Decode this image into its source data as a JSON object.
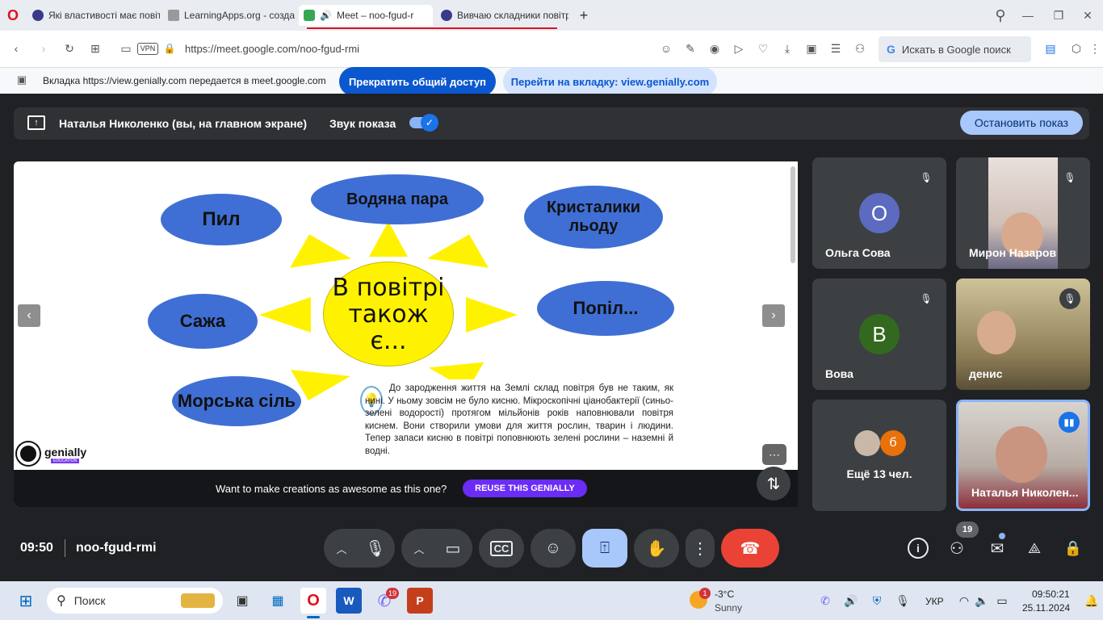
{
  "tabs": [
    {
      "label": "Які властивості має повіт",
      "color": "#3a3a8a"
    },
    {
      "label": "LearningApps.org - созда",
      "color": "#888"
    },
    {
      "label": "Meet – noo-fgud-r",
      "color": "#34a853"
    },
    {
      "label": "Вивчаю складники повітр",
      "color": "#3a3a8a"
    }
  ],
  "tabbar": {
    "new_tab": "+",
    "search": "⚲",
    "minimize": "—",
    "restore": "❐",
    "close": "✕"
  },
  "address": {
    "url": "https://meet.google.com/noo-fgud-rmi",
    "vpn": "VPN",
    "search_placeholder": "Искать в Google поиск"
  },
  "share_bar": {
    "message": "Вкладка https://view.genially.com передается в meet.google.com",
    "stop_label": "Прекратить общий доступ",
    "switch_label": "Перейти на вкладку: view.genially.com"
  },
  "presenter_bar": {
    "presenter": "Наталья Николенко (вы, на главном экране)",
    "sound_label": "Звук показа",
    "stop_label": "Остановить показ"
  },
  "slide": {
    "center_text": "В повітрі також є...",
    "clouds": [
      "Водяна пара",
      "Пил",
      "Кристалики льоду",
      "Сажа",
      "Попіл...",
      "Морська сіль"
    ],
    "paragraph": "До зародження життя на Землі склад повітря був не таким, як нині. У ньому зовсім не було кисню. Мікроскопічні ціанобактерії (синьо-зелені водорості) протягом мільйонів років наповнювали повітря киснем. Вони створили умови для життя рослин, тварин і людини. Тепер запаси кисню в повітрі поповнюють зелені рослини – наземні й водні.",
    "brand": "genially",
    "brand_sub": "EDUCATION",
    "prev": "‹",
    "next": "›",
    "more": "⋯",
    "promo_text": "Want to make creations as awesome as this one?",
    "promo_button": "REUSE THIS GENIALLY"
  },
  "participants": [
    {
      "name": "Ольга Сова",
      "initial": "О",
      "color": "#5c6bc0"
    },
    {
      "name": "Мирон Назаров",
      "initial": ""
    },
    {
      "name": "Вова",
      "initial": "В",
      "color": "#33691e"
    },
    {
      "name": "денис",
      "initial": ""
    },
    {
      "name": "Ещё 13 чел.",
      "initial": "б",
      "color": "#e8710a"
    },
    {
      "name": "Наталья Николен...",
      "initial": ""
    }
  ],
  "footer": {
    "time": "09:50",
    "meeting_code": "noo-fgud-rmi",
    "people_count": "19"
  },
  "taskbar": {
    "search": "Поиск",
    "weather_temp": "-3°C",
    "weather_text": "Sunny",
    "weather_badge": "1",
    "viber_badge": "19",
    "lang": "УКР",
    "clock_time": "09:50:21",
    "clock_date": "25.11.2024"
  }
}
